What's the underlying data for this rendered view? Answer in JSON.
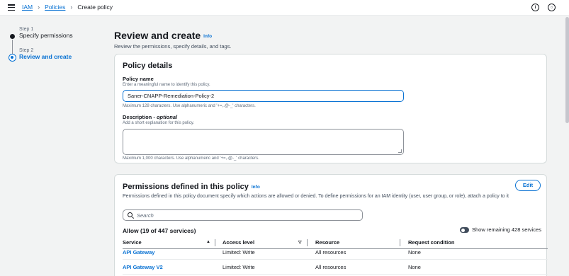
{
  "breadcrumb": {
    "items": [
      "IAM",
      "Policies"
    ],
    "current": "Create policy"
  },
  "steps": [
    {
      "num": "Step 1",
      "label": "Specify permissions"
    },
    {
      "num": "Step 2",
      "label": "Review and create"
    }
  ],
  "header": {
    "title": "Review and create",
    "info": "Info",
    "description": "Review the permissions, specify details, and tags."
  },
  "policy_details": {
    "title": "Policy details",
    "name_label": "Policy name",
    "name_desc": "Enter a meaningful name to identify this policy.",
    "name_value": "Saner-CNAPP-Remediation-Policy-2",
    "name_hint": "Maximum 128 characters. Use alphanumeric and '+=,.@-_' characters.",
    "desc_label": "Description - ",
    "desc_optional": "optional",
    "desc_desc": "Add a short explanation for this policy.",
    "desc_hint": "Maximum 1,000 characters. Use alphanumeric and '+=,.@-_' characters."
  },
  "permissions": {
    "title": "Permissions defined in this policy",
    "info": "Info",
    "edit": "Edit",
    "description": "Permissions defined in this policy document specify which actions are allowed or denied. To define permissions for an IAM identity (user, user group, or role), attach a policy to it",
    "search_placeholder": "Search",
    "allow_title": "Allow (19 of 447 services)",
    "toggle_label": "Show remaining 428 services",
    "columns": [
      "Service",
      "Access level",
      "Resource",
      "Request condition"
    ],
    "rows": [
      {
        "service": "API Gateway",
        "access": "Limited: Write",
        "resource": "All resources",
        "condition": "None"
      },
      {
        "service": "API Gateway V2",
        "access": "Limited: Write",
        "resource": "All resources",
        "condition": "None"
      }
    ]
  },
  "icons": {
    "menu": "hamburger-icon",
    "info": "info-circle-icon",
    "settings": "settings-icon",
    "search": "search-icon"
  },
  "colors": {
    "accent": "#0972d3",
    "text": "#16191f",
    "background": "#f2f3f3"
  }
}
